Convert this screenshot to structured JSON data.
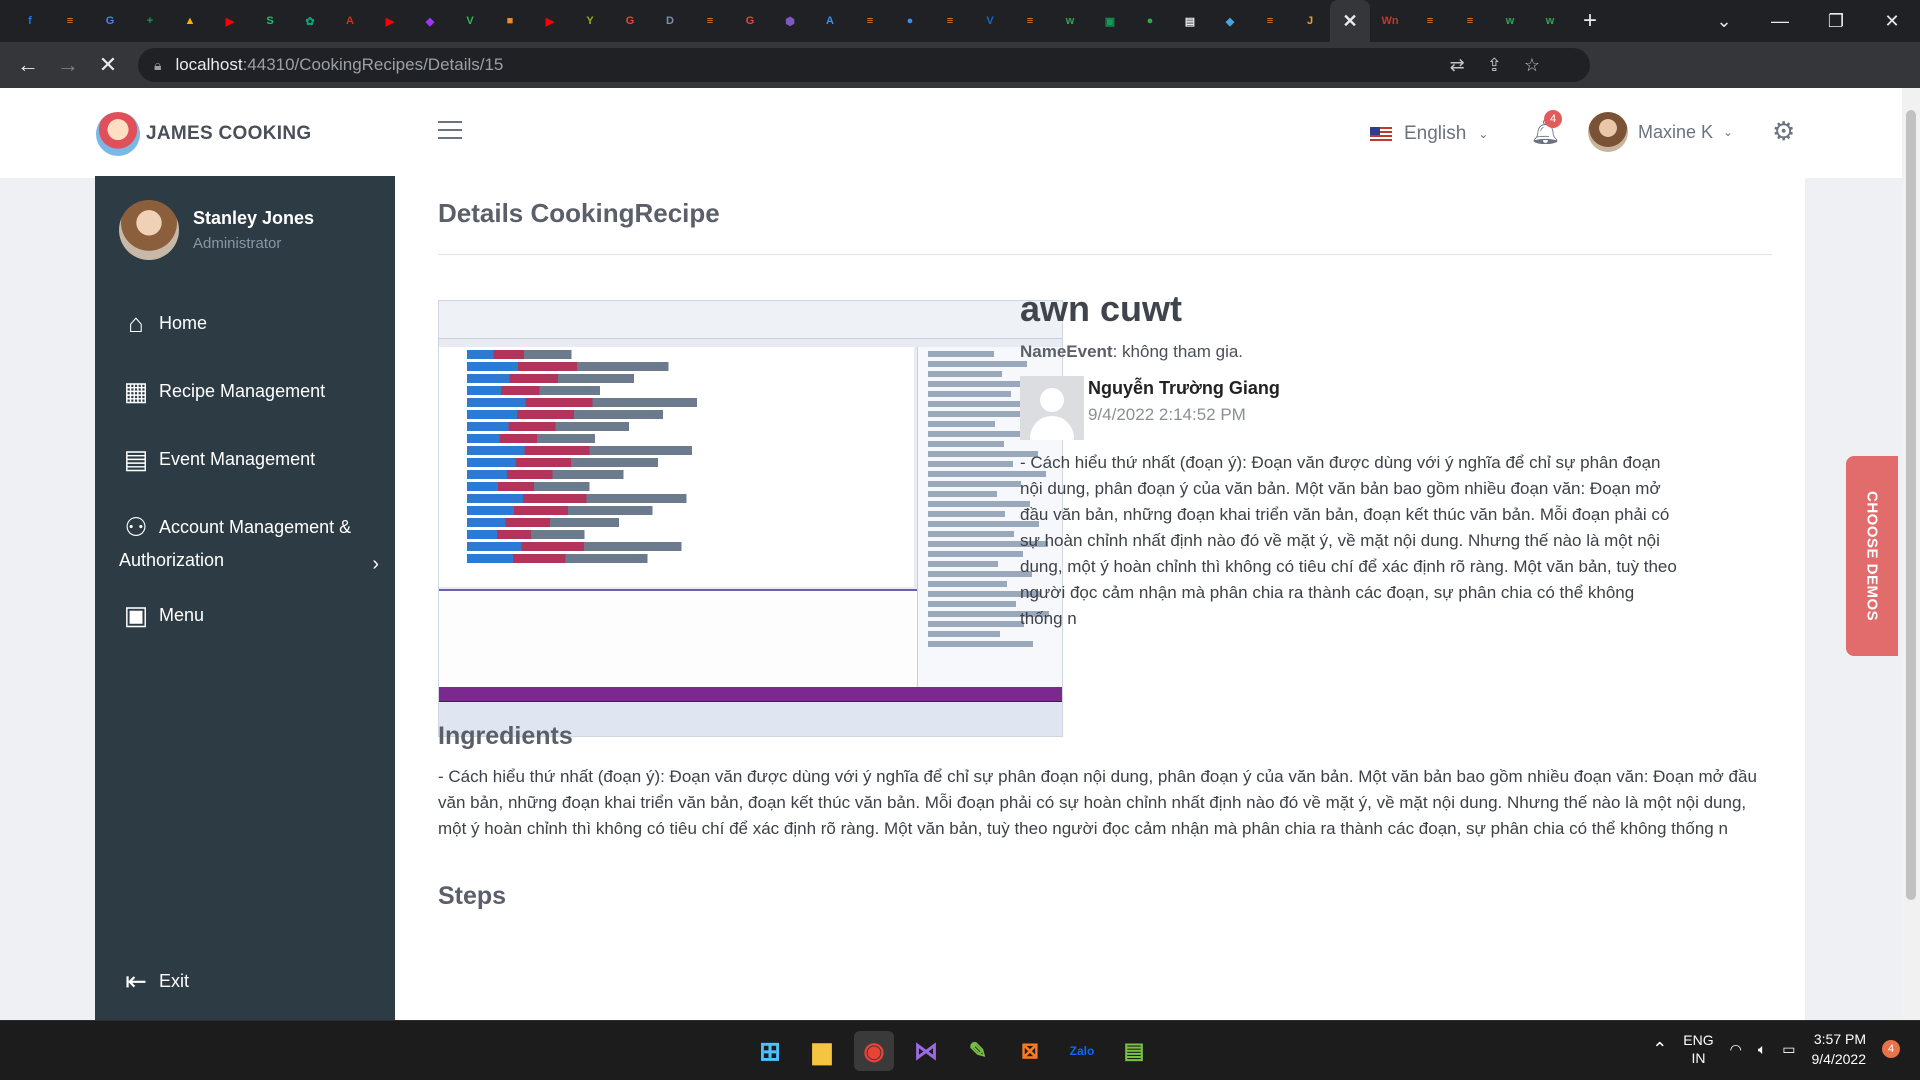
{
  "browser": {
    "url_host": "localhost",
    "url_path": ":44310/CookingRecipes/Details/15",
    "tab_favicons": [
      {
        "name": "facebook-favicon",
        "letter": "f",
        "color": "#1877f2"
      },
      {
        "name": "stackoverflow-favicon",
        "letter": "≡",
        "color": "#f48024"
      },
      {
        "name": "translate-favicon",
        "letter": "G",
        "color": "#4285f4"
      },
      {
        "name": "sheets-favicon",
        "letter": "+",
        "color": "#0f9d58"
      },
      {
        "name": "drive-favicon",
        "letter": "▲",
        "color": "#f4b400"
      },
      {
        "name": "youtube-favicon",
        "letter": "▶",
        "color": "#ff0000"
      },
      {
        "name": "s-favicon",
        "letter": "S",
        "color": "#1dbf73"
      },
      {
        "name": "chatgpt-favicon",
        "letter": "✿",
        "color": "#10a37f"
      },
      {
        "name": "acrobat-favicon",
        "letter": "A",
        "color": "#e4251b"
      },
      {
        "name": "youtube-favicon-2",
        "letter": "▶",
        "color": "#ff0000"
      },
      {
        "name": "messenger-favicon",
        "letter": "◆",
        "color": "#a033ff"
      },
      {
        "name": "v-favicon",
        "letter": "V",
        "color": "#2db84d"
      },
      {
        "name": "box-favicon",
        "letter": "■",
        "color": "#f28b2c"
      },
      {
        "name": "youtube-favicon-3",
        "letter": "▶",
        "color": "#ff0000"
      },
      {
        "name": "y-favicon",
        "letter": "Y",
        "color": "#8bb31d"
      },
      {
        "name": "google-favicon",
        "letter": "G",
        "color": "#ea4335"
      },
      {
        "name": "doc-favicon",
        "letter": "D",
        "color": "#7d8ea8"
      },
      {
        "name": "stackoverflow-favicon-2",
        "letter": "≡",
        "color": "#f48024"
      },
      {
        "name": "google-favicon-2",
        "letter": "G",
        "color": "#ea4335"
      },
      {
        "name": "hex-favicon",
        "letter": "⬢",
        "color": "#7e57c2"
      },
      {
        "name": "asp-favicon",
        "letter": "A",
        "color": "#3b8eea"
      },
      {
        "name": "stackoverflow-favicon-3",
        "letter": "≡",
        "color": "#f48024"
      },
      {
        "name": "circle-favicon",
        "letter": "●",
        "color": "#3b8eea"
      },
      {
        "name": "stackoverflow-favicon-4",
        "letter": "≡",
        "color": "#f48024"
      },
      {
        "name": "vuetify-favicon",
        "letter": "V",
        "color": "#1867c0"
      },
      {
        "name": "stackoverflow-favicon-5",
        "letter": "≡",
        "color": "#f48024"
      },
      {
        "name": "w-favicon",
        "letter": "w",
        "color": "#2ea44f"
      },
      {
        "name": "sheets-favicon-2",
        "letter": "▣",
        "color": "#0f9d58"
      },
      {
        "name": "map-favicon",
        "letter": "●",
        "color": "#34a853"
      },
      {
        "name": "doc-favicon-2",
        "letter": "▤",
        "color": "#e8eaed"
      },
      {
        "name": "cube-favicon",
        "letter": "◆",
        "color": "#4aa3df"
      },
      {
        "name": "stackoverflow-favicon-6",
        "letter": "≡",
        "color": "#f48024"
      },
      {
        "name": "j-favicon",
        "letter": "J",
        "color": "#f0a030"
      }
    ],
    "active_tab_icon": "✕",
    "tab_favicons_after": [
      {
        "name": "wn-favicon",
        "letter": "Wn",
        "color": "#c0392b"
      },
      {
        "name": "stackoverflow-favicon-7",
        "letter": "≡",
        "color": "#f48024"
      },
      {
        "name": "stackoverflow-favicon-8",
        "letter": "≡",
        "color": "#f48024"
      },
      {
        "name": "w-favicon-2",
        "letter": "w",
        "color": "#2ea44f"
      },
      {
        "name": "w-favicon-3",
        "letter": "w",
        "color": "#2ea44f"
      }
    ]
  },
  "header": {
    "brand": "JAMES COOKING",
    "language": "English",
    "notification_count": "4",
    "user_name": "Maxine K"
  },
  "sidebar": {
    "user_name": "Stanley Jones",
    "user_role": "Administrator",
    "items": [
      {
        "label": "Home",
        "icon": "home-icon"
      },
      {
        "label": "Recipe Management",
        "icon": "recipe-icon"
      },
      {
        "label": "Event Management",
        "icon": "calendar-icon"
      },
      {
        "label": "Account Management &",
        "label2": "Authorization",
        "icon": "user-gear-icon"
      },
      {
        "label": "Menu",
        "icon": "grid-icon"
      }
    ],
    "exit": "Exit"
  },
  "content": {
    "page_title": "Details CookingRecipe",
    "recipe_name": "awn cuwt",
    "name_event_label": "NameEvent",
    "name_event_value": ": không tham gia.",
    "author_name": "Nguyễn Trường Giang",
    "author_date": "9/4/2022 2:14:52 PM",
    "description": "- Cách hiểu thứ nhất (đoạn ý): Đoạn văn được dùng với ý nghĩa để chỉ sự phân đoạn nội dung, phân đoạn ý của văn bản. Một văn bản bao gồm nhiều đoạn văn: Đoạn mở đầu văn bản, những đoạn khai triển văn bản, đoạn kết thúc văn bản. Mỗi đoạn phải có sự hoàn chỉnh nhất định nào đó về mặt ý, về mặt nội dung. Nhưng thế nào là một nội dung, một ý hoàn chỉnh thì không có tiêu chí để xác định rõ ràng. Một văn bản, tuỳ theo người đọc cảm nhận mà phân chia ra thành các đoạn, sự phân chia có thể không thống n",
    "ingredients_title": "Ingredients",
    "ingredients_text": "- Cách hiểu thứ nhất (đoạn ý): Đoạn văn được dùng với ý nghĩa để chỉ sự phân đoạn nội dung, phân đoạn ý của văn bản. Một văn bản bao gồm nhiều đoạn văn: Đoạn mở đầu văn bản, những đoạn khai triển văn bản, đoạn kết thúc văn bản. Mỗi đoạn phải có sự hoàn chỉnh nhất định nào đó về mặt ý, về mặt nội dung. Nhưng thế nào là một nội dung, một ý hoàn chỉnh thì không có tiêu chí để xác định rõ ràng. Một văn bản, tuỳ theo người đọc cảm nhận mà phân chia ra thành các đoạn, sự phân chia có thể không thống n",
    "steps_title": "Steps"
  },
  "demos_label": "CHOOSE DEMOS",
  "taskbar": {
    "lang_top": "ENG",
    "lang_bottom": "IN",
    "time": "3:57 PM",
    "date": "9/4/2022",
    "notifications": "4"
  }
}
